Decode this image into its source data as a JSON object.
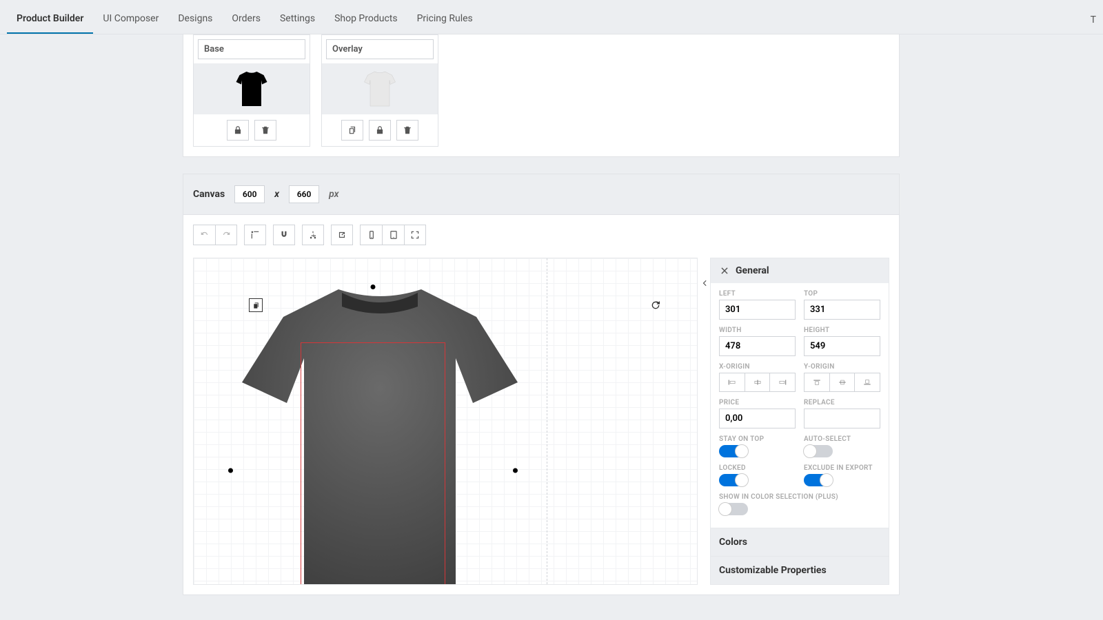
{
  "tabs": [
    "Product Builder",
    "UI Composer",
    "Designs",
    "Orders",
    "Settings",
    "Shop Products",
    "Pricing Rules"
  ],
  "activeTab": 0,
  "rightIndicator": "T",
  "layers": [
    {
      "title": "Base",
      "dark": true
    },
    {
      "title": "Overlay",
      "dark": false
    }
  ],
  "canvas": {
    "label": "Canvas",
    "w": "600",
    "h": "660",
    "unit": "px",
    "x": "x"
  },
  "general": {
    "title": "General",
    "left_label": "Left",
    "left": "301",
    "top_label": "Top",
    "top": "331",
    "width_label": "Width",
    "width": "478",
    "height_label": "Height",
    "height": "549",
    "xorigin_label": "X-Origin",
    "yorigin_label": "Y-Origin",
    "price_label": "Price",
    "price": "0,00",
    "replace_label": "Replace",
    "replace": "",
    "stay_label": "Stay on top",
    "stay": true,
    "auto_label": "Auto-Select",
    "auto": false,
    "locked_label": "Locked",
    "locked": true,
    "exclude_label": "Exclude in export",
    "exclude": true,
    "colorsel_label": "Show in color selection (Plus)",
    "colorsel": false
  },
  "accordions": [
    "Colors",
    "Customizable Properties"
  ]
}
